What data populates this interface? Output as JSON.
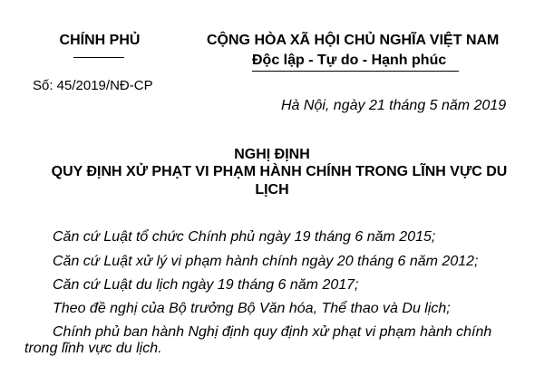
{
  "header": {
    "issuer": "CHÍNH PHỦ",
    "country": "CỘNG HÒA XÃ HỘI CHỦ NGHĨA VIỆT NAM",
    "motto": "Độc lập - Tự do - Hạnh phúc",
    "number": "Số: 45/2019/NĐ-CP",
    "place_date": "Hà Nội, ngày 21 tháng 5 năm 2019"
  },
  "title": {
    "doc_type": "NGHỊ ĐỊNH",
    "line1": "QUY ĐỊNH XỬ PHẠT VI PHẠM HÀNH CHÍNH TRONG LĨNH VỰC DU",
    "line2": "LỊCH"
  },
  "bases": [
    "Căn cứ Luật tổ chức Chính phủ ngày 19 tháng 6 năm 2015;",
    "Căn cứ Luật xử lý vi phạm hành chính ngày 20 tháng 6 năm 2012;",
    "Căn cứ Luật du lịch ngày 19 tháng 6 năm 2017;",
    "Theo đề nghị của Bộ trưởng Bộ Văn hóa, Thể thao và Du lịch;",
    "Chính phủ ban hành Nghị định quy định xử phạt vi phạm hành chính"
  ],
  "bases_continuation": "trong lĩnh vực du lịch."
}
